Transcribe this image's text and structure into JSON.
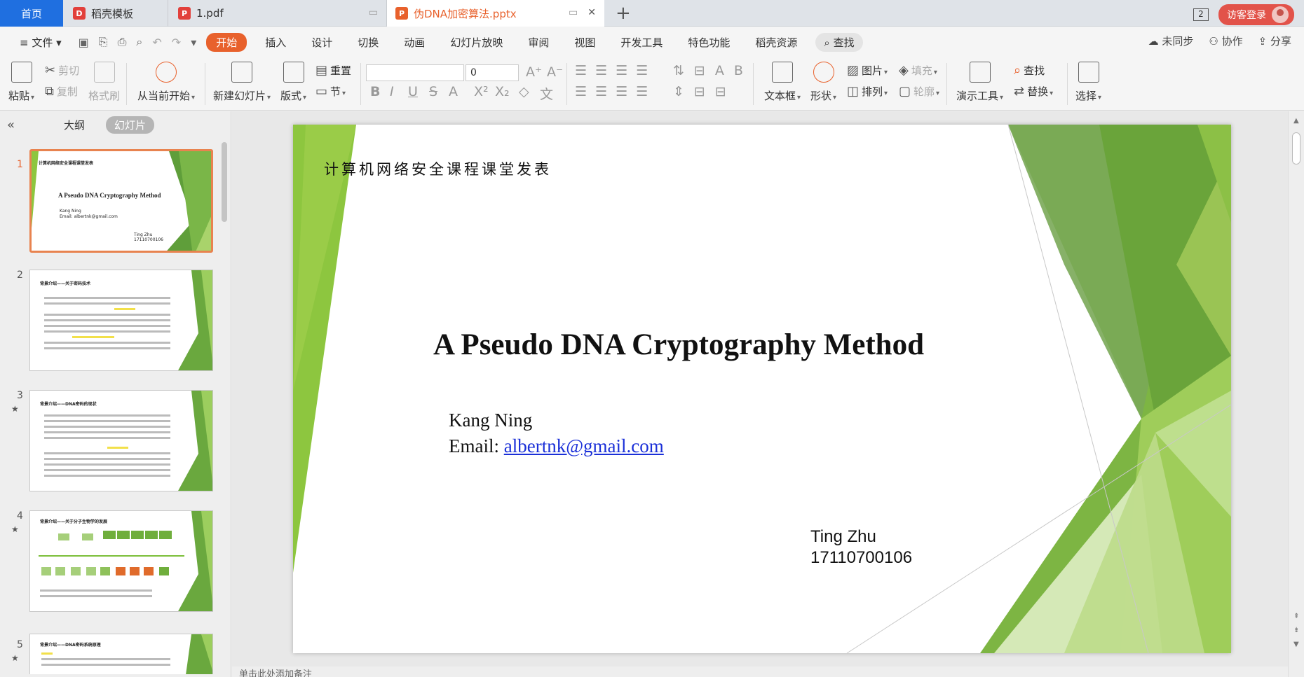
{
  "tabs": {
    "home": "首页",
    "t1": "稻壳模板",
    "t2": "1.pdf",
    "t3": "伪DNA加密算法.pptx",
    "window_count": "2",
    "login": "访客登录"
  },
  "menu": {
    "file": "文件",
    "items": [
      "开始",
      "插入",
      "设计",
      "切换",
      "动画",
      "幻灯片放映",
      "审阅",
      "视图",
      "开发工具",
      "特色功能",
      "稻壳资源"
    ],
    "search": "查找",
    "right": [
      "未同步",
      "协作",
      "分享"
    ]
  },
  "ribbon": {
    "paste": "粘贴",
    "cut": "剪切",
    "copy": "复制",
    "format_painter": "格式刷",
    "from_start": "从当前开始",
    "new_slide": "新建幻灯片",
    "layout": "版式",
    "reset": "重置",
    "section": "节",
    "font_size": "0",
    "textbox": "文本框",
    "shape": "形状",
    "picture": "图片",
    "fill": "填充",
    "arrange": "排列",
    "outline": "轮廓",
    "present_tools": "演示工具",
    "find": "查找",
    "replace": "替换",
    "select": "选择"
  },
  "panel": {
    "outline": "大纲",
    "slides": "幻灯片",
    "numbers": [
      "1",
      "2",
      "3",
      "4",
      "5"
    ]
  },
  "slide": {
    "header": "计算机网络安全课程课堂发表",
    "title": "A Pseudo DNA Cryptography Method",
    "author_name": "Kang Ning",
    "email_label": "Email: ",
    "email": "albertnk@gmail.com",
    "student_name": "Ting Zhu",
    "student_id": "17110700106"
  },
  "thumbs": {
    "t1_header": "计算机网络安全课程课堂发表",
    "t1_title": "A Pseudo DNA Cryptography Method",
    "t1_author": "Kang Ning",
    "t1_email": "Email: albertnk@gmail.com",
    "t1_student": "Ting Zhu",
    "t1_id": "17110700106",
    "t2_title": "背景介绍——关于密码技术",
    "t3_title": "背景介绍——DNA密码的现状",
    "t4_title": "背景介绍——关于分子生物学的发展",
    "t5_title": "背景介绍——DNA密码系统原理"
  },
  "notes": "单击此处添加备注"
}
